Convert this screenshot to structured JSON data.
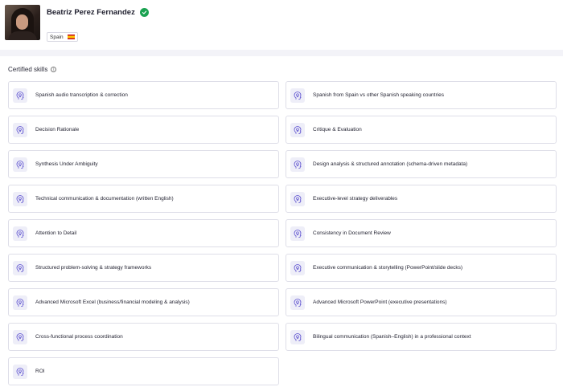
{
  "profile": {
    "name": "Beatriz Perez Fernandez",
    "country": "Spain",
    "verified_color": "#1aa251"
  },
  "skills_section": {
    "title": "Certified skills",
    "info_icon": "i"
  },
  "skills": [
    {
      "label": "Spanish audio transcription & correction",
      "icon": "head-bulb-icon"
    },
    {
      "label": "Spanish from Spain vs other Spanish speaking countries",
      "icon": "head-bulb-icon"
    },
    {
      "label": "Decision Rationale",
      "icon": "head-bulb-icon"
    },
    {
      "label": "Critique & Evaluation",
      "icon": "head-bulb-icon"
    },
    {
      "label": "Synthesis Under Ambiguity",
      "icon": "head-bulb-icon"
    },
    {
      "label": "Design analysis & structured annotation (schema-driven metadata)",
      "icon": "head-bulb-icon"
    },
    {
      "label": "Technical communication & documentation (written English)",
      "icon": "head-bulb-icon"
    },
    {
      "label": "Executive-level strategy deliverables",
      "icon": "head-bulb-icon"
    },
    {
      "label": "Attention to Detail",
      "icon": "head-bulb-icon"
    },
    {
      "label": "Consistency in Document Review",
      "icon": "head-bulb-icon"
    },
    {
      "label": "Structured problem-solving & strategy frameworks",
      "icon": "head-bulb-icon"
    },
    {
      "label": "Executive communication & storytelling (PowerPoint/slide decks)",
      "icon": "head-bulb-icon"
    },
    {
      "label": "Advanced Microsoft Excel (business/financial modeling & analysis)",
      "icon": "head-bulb-icon"
    },
    {
      "label": "Advanced Microsoft PowerPoint (executive presentations)",
      "icon": "head-bulb-icon"
    },
    {
      "label": "Cross-functional process coordination",
      "icon": "head-bulb-icon"
    },
    {
      "label": "Bilingual communication (Spanish–English) in a professional context",
      "icon": "head-bulb-icon"
    },
    {
      "label": "ROI",
      "icon": "head-bulb-icon"
    }
  ]
}
